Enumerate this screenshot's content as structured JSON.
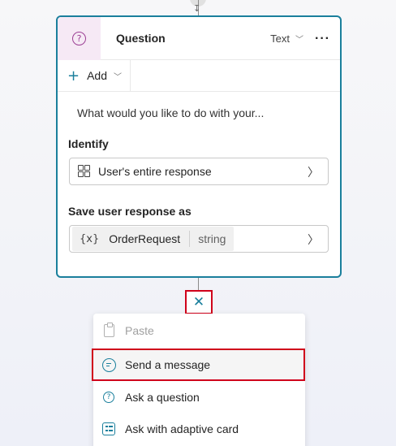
{
  "card": {
    "title": "Question",
    "type_label": "Text",
    "more_label": "···",
    "add_label": "Add",
    "prompt_text": "What would you like to do with your...",
    "identify_label": "Identify",
    "identify_value": "User's entire response",
    "save_label": "Save user response as",
    "variable_token": "{x}",
    "variable_name": "OrderRequest",
    "variable_type": "string"
  },
  "menu": {
    "items": [
      {
        "label": "Paste",
        "icon": "paste-icon",
        "disabled": true
      },
      {
        "label": "Send a message",
        "icon": "chat-icon",
        "selected": true
      },
      {
        "label": "Ask a question",
        "icon": "question-icon"
      },
      {
        "label": "Ask with adaptive card",
        "icon": "adaptive-card-icon"
      }
    ]
  },
  "colors": {
    "accent": "#1a7f9c",
    "highlight": "#d0021b",
    "question_icon": "#9c3f94"
  }
}
